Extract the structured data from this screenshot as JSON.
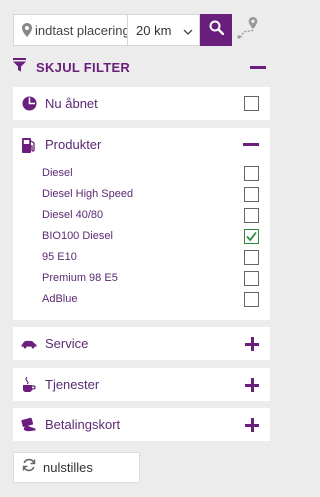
{
  "search": {
    "location_placeholder": "indtast placering",
    "distance_value": "20 km"
  },
  "filter": {
    "toggle_label": "SKJUL FILTER"
  },
  "open_now": {
    "label": "Nu åbnet",
    "checked": false
  },
  "products": {
    "label": "Produkter",
    "items": [
      {
        "label": "Diesel",
        "checked": false
      },
      {
        "label": "Diesel High Speed",
        "checked": false
      },
      {
        "label": "Diesel 40/80",
        "checked": false
      },
      {
        "label": "BIO100 Diesel",
        "checked": true
      },
      {
        "label": "95 E10",
        "checked": false
      },
      {
        "label": "Premium 98 E5",
        "checked": false
      },
      {
        "label": "AdBlue",
        "checked": false
      }
    ]
  },
  "sections": [
    {
      "label": "Service",
      "icon": "car-icon"
    },
    {
      "label": "Tjenester",
      "icon": "coffee-cup-icon"
    },
    {
      "label": "Betalingskort",
      "icon": "card-in-hand-icon"
    }
  ],
  "reset": {
    "label": "nulstilles"
  },
  "colors": {
    "accent": "#6a1f7c",
    "check": "#2a8b3a",
    "background": "#ececec"
  }
}
